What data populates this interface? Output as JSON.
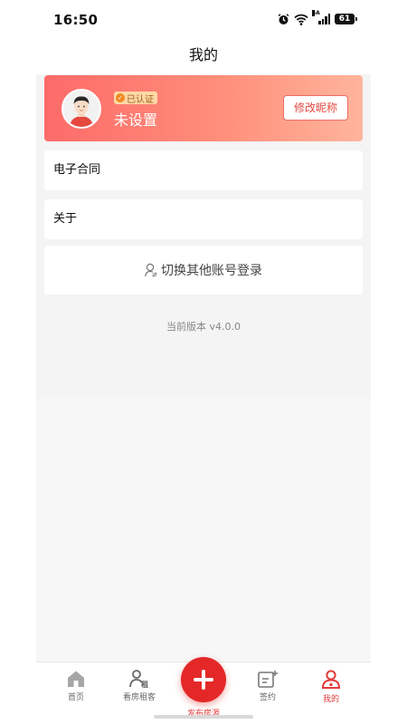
{
  "status_bar": {
    "time": "16:50",
    "network": "5A",
    "battery": "61"
  },
  "header": {
    "title": "我的"
  },
  "profile": {
    "verified_badge": "已认证",
    "nickname": "未设置",
    "edit_button": "修改昵称"
  },
  "menu": {
    "contract": "电子合同",
    "about": "关于",
    "switch_account": "切换其他账号登录"
  },
  "version_text": "当前版本 v4.0.0",
  "tabbar": {
    "home": "首页",
    "rent": "看房租客",
    "center": "发布房源",
    "sign": "签约",
    "mine": "我的",
    "active": "mine"
  },
  "colors": {
    "accent": "#e42828",
    "card_gradient_start": "#fd6b69",
    "card_gradient_end": "#ffb59c"
  }
}
